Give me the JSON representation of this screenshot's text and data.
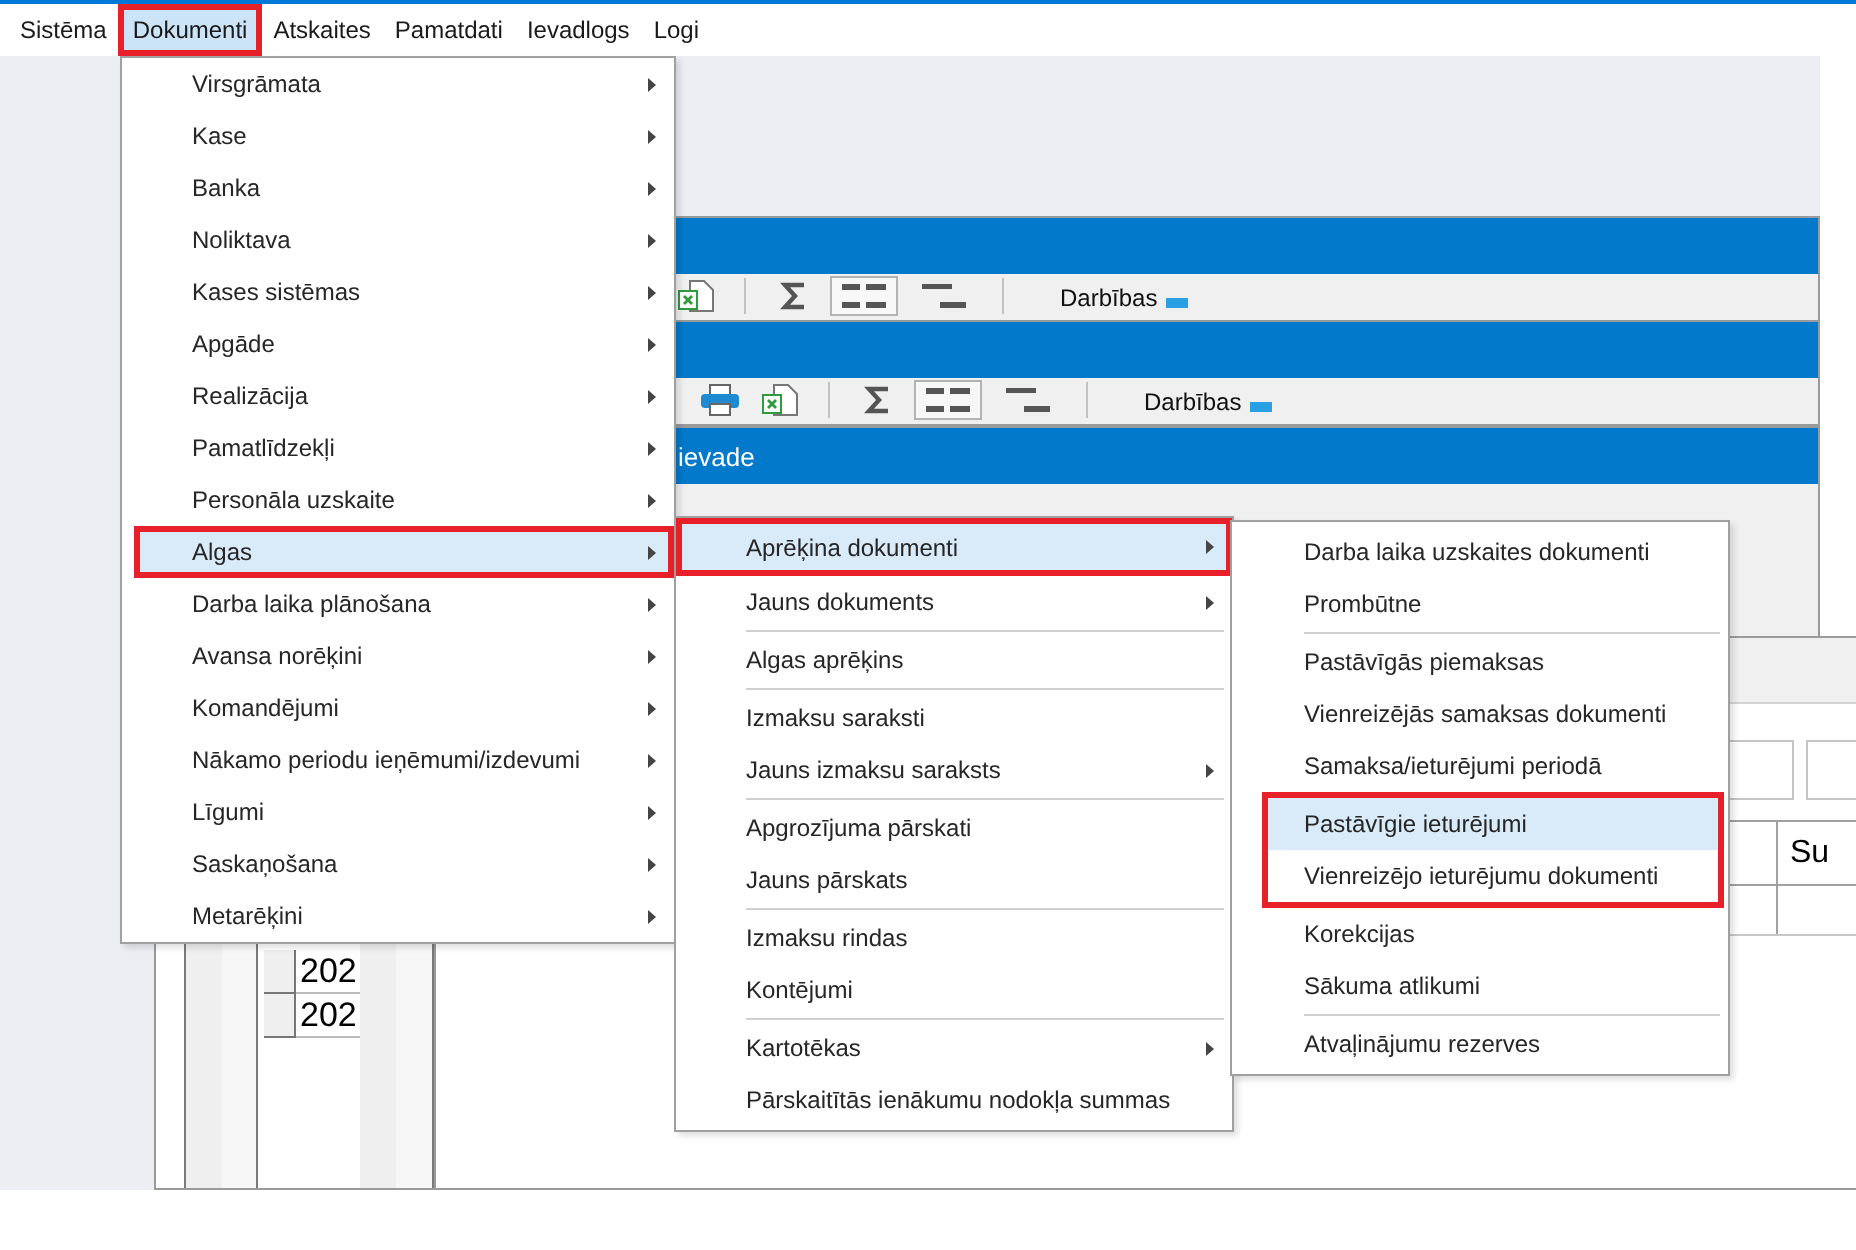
{
  "menu_bar": {
    "items": [
      {
        "label": "Sistēma",
        "selected": false,
        "marked": false
      },
      {
        "label": "Dokumenti",
        "selected": true,
        "marked": true
      },
      {
        "label": "Atskaites",
        "selected": false,
        "marked": false
      },
      {
        "label": "Pamatdati",
        "selected": false,
        "marked": false
      },
      {
        "label": "Ievadlogs",
        "selected": false,
        "marked": false
      },
      {
        "label": "Logi",
        "selected": false,
        "marked": false
      }
    ]
  },
  "windows": [
    {
      "kind": "window",
      "toolbar": {
        "groups": [
          {
            "tools": [
              {
                "kind": "export",
                "pressed": false
              }
            ]
          },
          {
            "tools": [
              {
                "kind": "sum",
                "pressed": false
              },
              {
                "kind": "list",
                "pressed": true
              },
              {
                "kind": "align",
                "pressed": false
              }
            ]
          }
        ],
        "actions_menu": "Darbības"
      }
    },
    {
      "kind": "window",
      "toolbar": {
        "groups": [
          {
            "tools": [
              {
                "kind": "print",
                "pressed": false
              },
              {
                "kind": "export",
                "pressed": false
              }
            ]
          },
          {
            "tools": [
              {
                "kind": "sum",
                "pressed": false
              },
              {
                "kind": "list",
                "pressed": true
              },
              {
                "kind": "align",
                "pressed": false
              }
            ]
          }
        ],
        "actions_menu": "Darbības"
      }
    },
    {
      "kind": "window",
      "title": "ievade",
      "grid": {
        "rows": [
          {
            "cells": [
              "202"
            ]
          },
          {
            "cells": [
              "202"
            ]
          }
        ]
      }
    },
    {
      "kind": "panel",
      "table": {
        "columns": [
          "Su"
        ]
      }
    }
  ],
  "menus": [
    {
      "sections": [
        {
          "items": [
            {
              "label": "Virsgrāmata",
              "submenu": true,
              "selected": false,
              "marked": false
            },
            {
              "label": "Kase",
              "submenu": true,
              "selected": false,
              "marked": false
            },
            {
              "label": "Banka",
              "submenu": true,
              "selected": false,
              "marked": false
            },
            {
              "label": "Noliktava",
              "submenu": true,
              "selected": false,
              "marked": false
            },
            {
              "label": "Kases sistēmas",
              "submenu": true,
              "selected": false,
              "marked": false
            },
            {
              "label": "Apgāde",
              "submenu": true,
              "selected": false,
              "marked": false
            },
            {
              "label": "Realizācija",
              "submenu": true,
              "selected": false,
              "marked": false
            },
            {
              "label": "Pamatlīdzekļi",
              "submenu": true,
              "selected": false,
              "marked": false
            },
            {
              "label": "Personāla uzskaite",
              "submenu": true,
              "selected": false,
              "marked": false
            },
            {
              "label": "Algas",
              "submenu": true,
              "selected": true,
              "marked": true
            },
            {
              "label": "Darba laika plānošana",
              "submenu": true,
              "selected": false,
              "marked": false
            },
            {
              "label": "Avansa norēķini",
              "submenu": true,
              "selected": false,
              "marked": false
            },
            {
              "label": "Komandējumi",
              "submenu": true,
              "selected": false,
              "marked": false
            },
            {
              "label": "Nākamo periodu ieņēmumi/izdevumi",
              "submenu": true,
              "selected": false,
              "marked": false
            },
            {
              "label": "Līgumi",
              "submenu": true,
              "selected": false,
              "marked": false
            },
            {
              "label": "Saskaņošana",
              "submenu": true,
              "selected": false,
              "marked": false
            },
            {
              "label": "Metarēķini",
              "submenu": true,
              "selected": false,
              "marked": false
            }
          ]
        }
      ]
    },
    {
      "sections": [
        {
          "items": [
            {
              "label": "Aprēķina dokumenti",
              "submenu": true,
              "selected": true,
              "marked": true
            },
            {
              "label": "Jauns dokuments",
              "submenu": true,
              "selected": false,
              "marked": false
            }
          ]
        },
        {
          "items": [
            {
              "label": "Algas aprēķins",
              "submenu": false,
              "selected": false,
              "marked": false
            }
          ]
        },
        {
          "items": [
            {
              "label": "Izmaksu saraksti",
              "submenu": false,
              "selected": false,
              "marked": false
            },
            {
              "label": "Jauns izmaksu saraksts",
              "submenu": true,
              "selected": false,
              "marked": false
            }
          ]
        },
        {
          "items": [
            {
              "label": "Apgrozījuma pārskati",
              "submenu": false,
              "selected": false,
              "marked": false
            },
            {
              "label": "Jauns pārskats",
              "submenu": false,
              "selected": false,
              "marked": false
            }
          ]
        },
        {
          "items": [
            {
              "label": "Izmaksu rindas",
              "submenu": false,
              "selected": false,
              "marked": false
            },
            {
              "label": "Kontējumi",
              "submenu": false,
              "selected": false,
              "marked": false
            }
          ]
        },
        {
          "items": [
            {
              "label": "Kartotēkas",
              "submenu": true,
              "selected": false,
              "marked": false
            },
            {
              "label": "Pārskaitītās ienākumu nodokļa summas",
              "submenu": false,
              "selected": false,
              "marked": false
            }
          ]
        }
      ]
    },
    {
      "sections": [
        {
          "items": [
            {
              "label": "Darba laika uzskaites dokumenti",
              "submenu": false,
              "selected": false,
              "marked": false
            },
            {
              "label": "Prombūtne",
              "submenu": false,
              "selected": false,
              "marked": false
            }
          ]
        },
        {
          "items": [
            {
              "label": "Pastāvīgās piemaksas",
              "submenu": false,
              "selected": false,
              "marked": false
            },
            {
              "label": "Vienreizējās samaksas dokumenti",
              "submenu": false,
              "selected": false,
              "marked": false
            },
            {
              "label": "Samaksa/ieturējumi periodā",
              "submenu": false,
              "selected": false,
              "marked": false
            },
            {
              "label": "Pastāvīgie ieturējumi",
              "submenu": false,
              "selected": true,
              "marked": true
            },
            {
              "label": "Vienreizējo ieturējumu dokumenti",
              "submenu": false,
              "selected": false,
              "marked": true
            },
            {
              "label": "Korekcijas",
              "submenu": false,
              "selected": false,
              "marked": false
            },
            {
              "label": "Sākuma atlikumi",
              "submenu": false,
              "selected": false,
              "marked": false
            }
          ]
        },
        {
          "items": [
            {
              "label": "Atvaļinājumu rezerves",
              "submenu": false,
              "selected": false,
              "marked": false
            }
          ]
        }
      ]
    }
  ]
}
